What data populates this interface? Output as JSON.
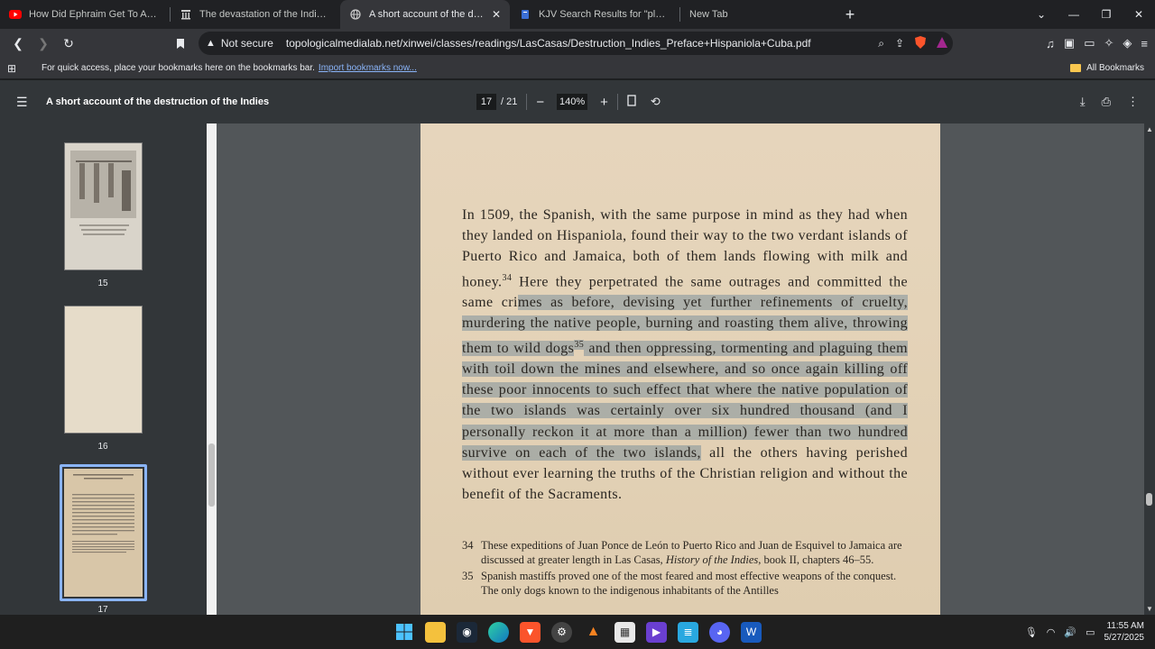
{
  "tabs": [
    {
      "title": "How Did Ephraim Get To America?",
      "icon": "youtube-icon",
      "color": "#ff0000"
    },
    {
      "title": "The devastation of the Indies : a brief account",
      "icon": "archive-icon"
    },
    {
      "title": "A short account of the destruction of the Indies",
      "icon": "globe-icon",
      "active": true
    },
    {
      "title": "KJV Search Results for \"pleasant\" All",
      "icon": "bible-icon"
    },
    {
      "title": "New Tab",
      "icon": ""
    }
  ],
  "address": {
    "security": "Not secure",
    "url": "topologicalmedialab.net/xinwei/classes/readings/LasCasas/Destruction_Indies_Preface+Hispaniola+Cuba.pdf"
  },
  "bookmarks_bar": {
    "message": "For quick access, place your bookmarks here on the bookmarks bar.",
    "import_link": "Import bookmarks now...",
    "all_bookmarks": "All Bookmarks"
  },
  "pdf_toolbar": {
    "title": "A short account of the destruction of the Indies",
    "page_current": "17",
    "page_total": "/ 21",
    "zoom": "140%"
  },
  "thumbnails": [
    {
      "label": "15"
    },
    {
      "label": "16"
    },
    {
      "label": "17",
      "selected": true
    }
  ],
  "page": {
    "text_before": "In 1509, the Spanish, with the same purpose in mind as they had when they landed on Hispaniola, found their way to the two verdant islands of Puerto Rico and Jamaica, both of them lands flowing with milk and honey.",
    "sup34": "34",
    "text_mid": " Here they perpetrated the same outrages and committed the same cri",
    "highlighted_a": "mes as before, devising yet further refinements of cruelty, murdering the native people, burning and roasting them alive, throwing them to wild dogs",
    "sup35": "35",
    "highlighted_b": " and then oppressing, tormenting and plaguing them with toil down the mines and elsewhere, and so once again killing off these poor innocents to such effect that where the native population of the two islands was certainly over six hundred thousand (and I personally reckon it at more than a million) fewer than two hundred survive on each of the two islands,",
    "text_after": " all the others having perished without ever learning the truths of the Christian religion and without the benefit of the Sacraments.",
    "footnotes": [
      {
        "num": "34",
        "text_a": "These expeditions of Juan Ponce de León to Puerto Rico and Juan de Esquivel to Jamaica are discussed at greater length in Las Casas, ",
        "italic": "History of the Indies",
        "text_b": ", book II, chapters 46–55."
      },
      {
        "num": "35",
        "text_a": "Spanish mastiffs proved one of the most feared and most effective weapons of the conquest. The only dogs known to the indigenous inhabitants of the Antilles",
        "italic": "",
        "text_b": ""
      }
    ]
  },
  "clock": {
    "time": "11:55 AM",
    "date": "5/27/2025"
  }
}
